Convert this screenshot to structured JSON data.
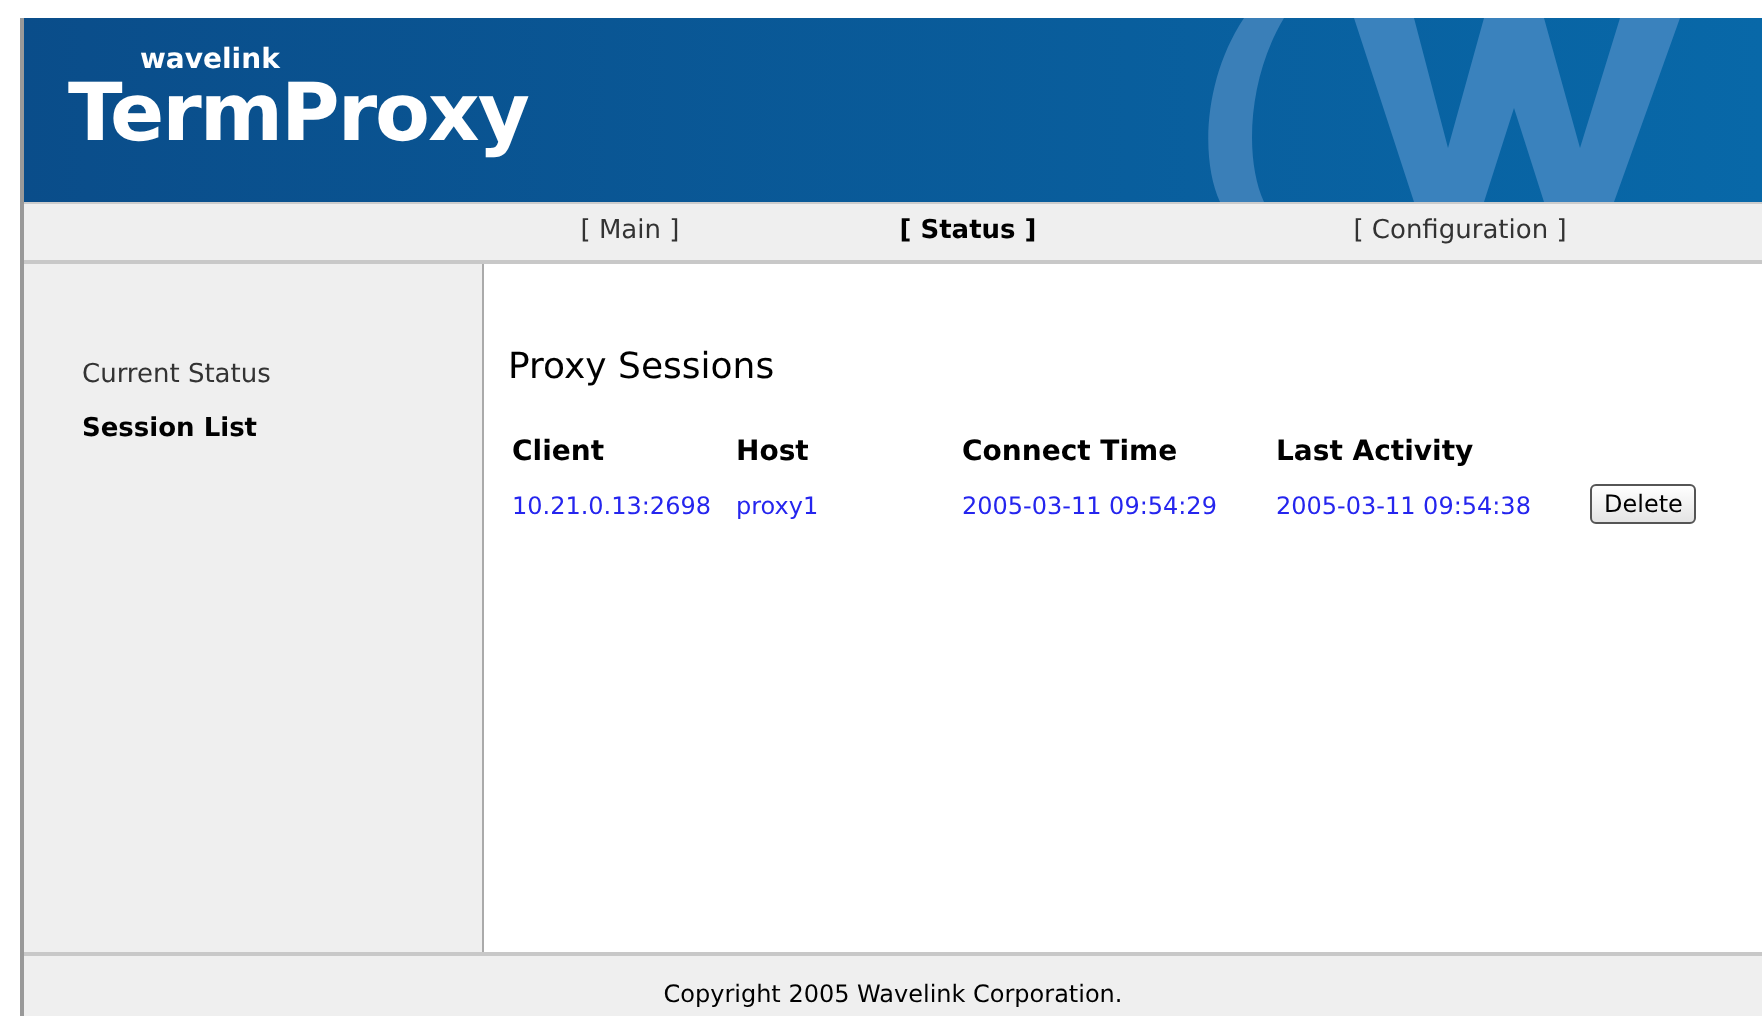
{
  "header": {
    "brand_small": "wavelink",
    "brand": "TermProxy"
  },
  "nav": [
    {
      "label": "[ Main ]",
      "selected": false
    },
    {
      "label": "[ Status ]",
      "selected": true
    },
    {
      "label": "[ Configuration ]",
      "selected": false
    }
  ],
  "sidebar": {
    "items": [
      {
        "label": "Current Status",
        "selected": false
      },
      {
        "label": "Session List",
        "selected": true
      }
    ]
  },
  "main": {
    "title": "Proxy Sessions",
    "table": {
      "columns": [
        "Client",
        "Host",
        "Connect Time",
        "Last Activity"
      ],
      "rows": [
        {
          "cells": [
            "10.21.0.13:2698",
            "proxy1",
            "2005-03-11 09:54:29",
            "2005-03-11 09:54:38"
          ],
          "action": "Delete"
        }
      ]
    }
  },
  "footer": "Copyright 2005 Wavelink Corporation."
}
